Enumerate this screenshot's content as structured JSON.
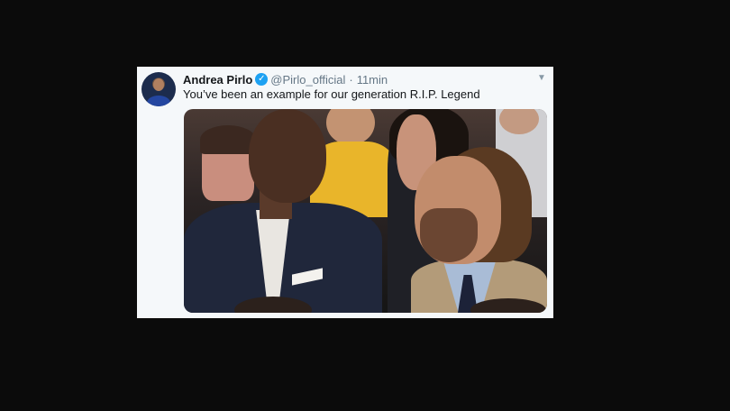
{
  "tweet": {
    "author_name": "Andrea Pirlo",
    "verified_icon": "verified-badge-icon",
    "handle": "@Pirlo_official",
    "separator": "·",
    "timestamp": "11min",
    "text": "You’ve been an example for our generation R.I.P. Legend",
    "menu_icon": "chevron-down-icon"
  },
  "colors": {
    "page_background": "#0b0b0b",
    "card_background": "#f5f8fa",
    "verified_blue": "#1da1f2",
    "secondary_text": "#657786"
  }
}
